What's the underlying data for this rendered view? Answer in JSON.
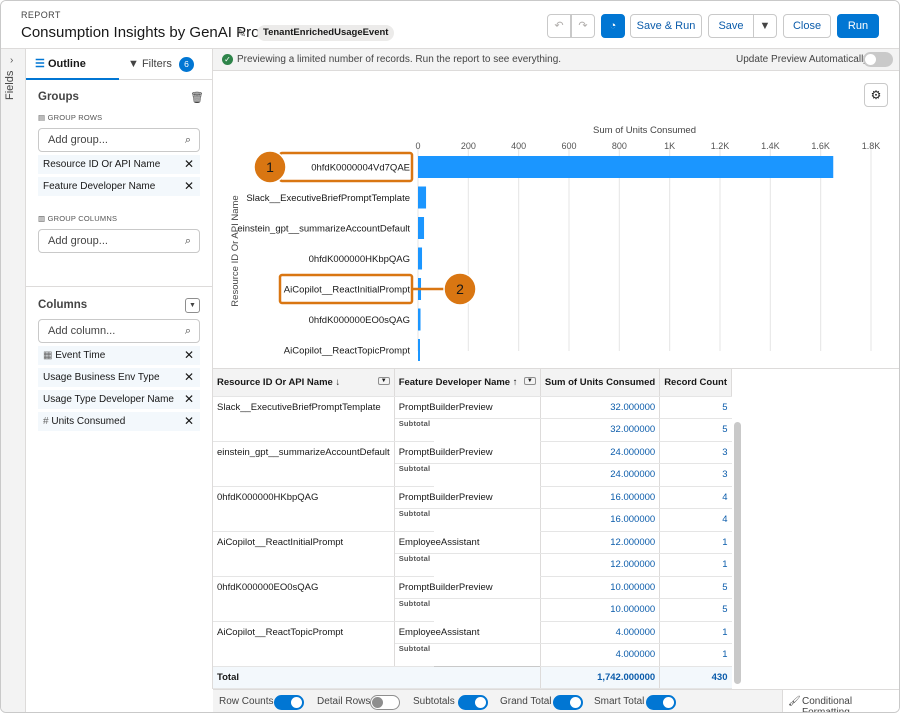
{
  "header": {
    "kicker": "REPORT",
    "title": "Consumption Insights by GenAI Prompt",
    "object_pill": "TenantEnrichedUsageEvent",
    "undo_icon": "undo-icon",
    "redo_icon": "redo-icon",
    "chart_icon": "chart-icon",
    "save_run_label": "Save & Run",
    "save_label": "Save",
    "close_label": "Close",
    "run_label": "Run"
  },
  "left_rail": {
    "label": "Fields"
  },
  "sidebar": {
    "tabs": [
      {
        "label": "Outline"
      },
      {
        "label": "Filters",
        "badge": "6"
      }
    ],
    "groups_title": "Groups",
    "group_rows_label": "GROUP ROWS",
    "add_group_placeholder": "Add group...",
    "group_rows": [
      "Resource ID Or API Name",
      "Feature Developer Name"
    ],
    "group_columns_label": "GROUP COLUMNS",
    "add_group_col_placeholder": "Add group...",
    "columns_title": "Columns",
    "add_column_placeholder": "Add column...",
    "columns": [
      "Event Time",
      "Usage Business Env Type",
      "Usage Type Developer Name",
      "Units Consumed"
    ]
  },
  "banner": {
    "message": "Previewing a limited number of records. Run the report to see everything.",
    "auto_update_label": "Update Preview Automatically",
    "auto_update_on": false
  },
  "callouts": [
    {
      "number": "1"
    },
    {
      "number": "2"
    }
  ],
  "chart_data": {
    "type": "bar",
    "orientation": "horizontal",
    "title": "Sum of Units Consumed",
    "ylabel": "Resource ID Or API Name",
    "xlabel": "",
    "tick_labels": [
      "0",
      "200",
      "400",
      "600",
      "800",
      "1K",
      "1.2K",
      "1.4K",
      "1.6K",
      "1.8K"
    ],
    "xlim": [
      0,
      1800
    ],
    "categories": [
      "0hfdK0000004Vd7QAE",
      "Slack__ExecutiveBriefPromptTemplate",
      "einstein_gpt__summarizeAccountDefault",
      "0hfdK000000HKbpQAG",
      "AiCopilot__ReactInitialPrompt",
      "0hfdK000000EO0sQAG",
      "AiCopilot__ReactTopicPrompt"
    ],
    "values": [
      1650,
      32,
      24,
      16,
      12,
      10,
      4
    ],
    "color": "#1b96ff",
    "grid": true
  },
  "table": {
    "headers": [
      "Resource ID Or API Name",
      "Feature Developer Name",
      "Sum of Units Consumed",
      "Record Count"
    ],
    "rows": [
      {
        "resource": "Slack__ExecutiveBriefPromptTemplate",
        "feature": "PromptBuilderPreview",
        "sum": "32.000000",
        "count": "5",
        "subtotal_label": "Subtotal",
        "subtotal_sum": "32.000000",
        "subtotal_count": "5"
      },
      {
        "resource": "einstein_gpt__summarizeAccountDefault",
        "feature": "PromptBuilderPreview",
        "sum": "24.000000",
        "count": "3",
        "subtotal_label": "Subtotal",
        "subtotal_sum": "24.000000",
        "subtotal_count": "3"
      },
      {
        "resource": "0hfdK000000HKbpQAG",
        "feature": "PromptBuilderPreview",
        "sum": "16.000000",
        "count": "4",
        "subtotal_label": "Subtotal",
        "subtotal_sum": "16.000000",
        "subtotal_count": "4"
      },
      {
        "resource": "AiCopilot__ReactInitialPrompt",
        "feature": "EmployeeAssistant",
        "sum": "12.000000",
        "count": "1",
        "subtotal_label": "Subtotal",
        "subtotal_sum": "12.000000",
        "subtotal_count": "1"
      },
      {
        "resource": "0hfdK000000EO0sQAG",
        "feature": "PromptBuilderPreview",
        "sum": "10.000000",
        "count": "5",
        "subtotal_label": "Subtotal",
        "subtotal_sum": "10.000000",
        "subtotal_count": "5"
      },
      {
        "resource": "AiCopilot__ReactTopicPrompt",
        "feature": "EmployeeAssistant",
        "sum": "4.000000",
        "count": "1",
        "subtotal_label": "Subtotal",
        "subtotal_sum": "4.000000",
        "subtotal_count": "1"
      }
    ],
    "total": {
      "label": "Total",
      "sum": "1,742.000000",
      "count": "430"
    }
  },
  "footer": {
    "row_counts": {
      "label": "Row Counts",
      "on": true
    },
    "detail_rows": {
      "label": "Detail Rows",
      "on": false
    },
    "subtotals": {
      "label": "Subtotals",
      "on": true
    },
    "grand_total": {
      "label": "Grand Total",
      "on": true
    },
    "smart_total": {
      "label": "Smart Total",
      "on": true
    },
    "conditional_formatting": "Conditional Formatting"
  }
}
